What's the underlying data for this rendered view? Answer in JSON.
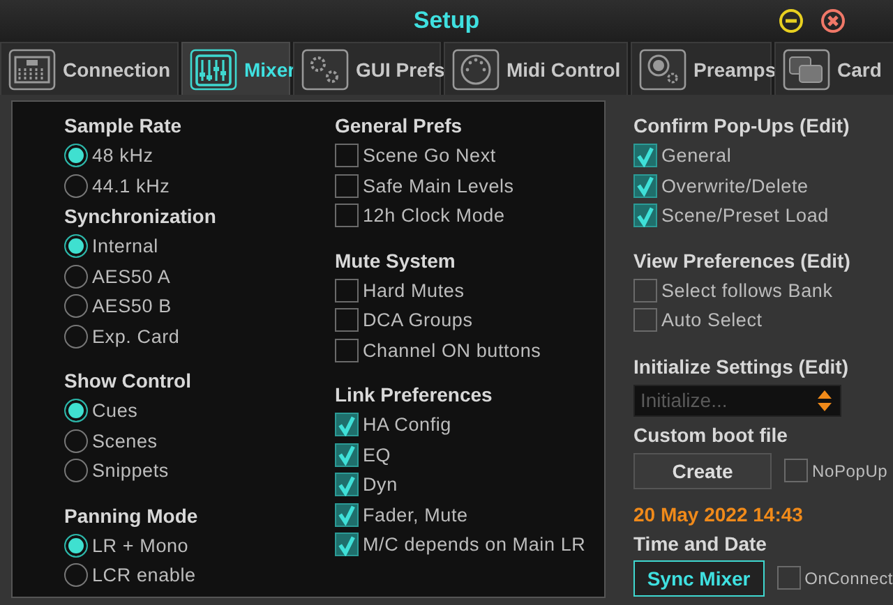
{
  "window": {
    "title": "Setup"
  },
  "tabs": [
    {
      "label": "Connection",
      "selected": false
    },
    {
      "label": "Mixer",
      "selected": true
    },
    {
      "label": "GUI Prefs",
      "selected": false
    },
    {
      "label": "Midi Control",
      "selected": false
    },
    {
      "label": "Preamps",
      "selected": false
    },
    {
      "label": "Card",
      "selected": false
    }
  ],
  "columns": [
    [
      {
        "heading": "Sample Rate",
        "kind": "radio",
        "items": [
          {
            "label": "48 kHz",
            "selected": true
          },
          {
            "label": "44.1 kHz",
            "selected": false
          }
        ]
      },
      {
        "heading": "Synchronization",
        "kind": "radio",
        "items": [
          {
            "label": "Internal",
            "selected": true
          },
          {
            "label": "AES50 A",
            "selected": false
          },
          {
            "label": "AES50 B",
            "selected": false
          },
          {
            "label": "Exp. Card",
            "selected": false
          }
        ]
      },
      {
        "heading": "Show Control",
        "kind": "radio",
        "items": [
          {
            "label": "Cues",
            "selected": true
          },
          {
            "label": "Scenes",
            "selected": false
          },
          {
            "label": "Snippets",
            "selected": false
          }
        ]
      },
      {
        "heading": "Panning Mode",
        "kind": "radio",
        "items": [
          {
            "label": "LR + Mono",
            "selected": true
          },
          {
            "label": "LCR enable",
            "selected": false
          }
        ]
      }
    ],
    [
      {
        "heading": "General Prefs",
        "kind": "check",
        "items": [
          {
            "label": "Scene Go Next",
            "checked": false
          },
          {
            "label": "Safe Main Levels",
            "checked": false
          },
          {
            "label": "12h Clock Mode",
            "checked": false
          }
        ]
      },
      {
        "heading": "Mute System",
        "kind": "check",
        "items": [
          {
            "label": "Hard Mutes",
            "checked": false
          },
          {
            "label": "DCA Groups",
            "checked": false
          },
          {
            "label": "Channel ON buttons",
            "checked": false
          }
        ]
      },
      {
        "heading": "Link Preferences",
        "kind": "check",
        "items": [
          {
            "label": "HA Config",
            "checked": true
          },
          {
            "label": "EQ",
            "checked": true
          },
          {
            "label": "Dyn",
            "checked": true
          },
          {
            "label": "Fader, Mute",
            "checked": true
          },
          {
            "label": "M/C depends on Main LR",
            "checked": true
          }
        ]
      }
    ]
  ],
  "confirm_popups": {
    "heading": "Confirm Pop-Ups (Edit)",
    "kind": "check",
    "items": [
      {
        "label": "General",
        "checked": true
      },
      {
        "label": "Overwrite/Delete",
        "checked": true
      },
      {
        "label": "Scene/Preset Load",
        "checked": true
      }
    ]
  },
  "view_preferences": {
    "heading": "View Preferences (Edit)",
    "kind": "check",
    "items": [
      {
        "label": "Select follows Bank",
        "checked": false
      },
      {
        "label": "Auto Select",
        "checked": false
      }
    ]
  },
  "initialize": {
    "heading": "Initialize Settings (Edit)",
    "placeholder": "Initialize..."
  },
  "boot_file": {
    "heading": "Custom boot file",
    "button": "Create",
    "option": {
      "label": "NoPopUp",
      "checked": false
    }
  },
  "time": {
    "date": "20 May 2022 14:43",
    "heading": "Time and Date",
    "button": "Sync Mixer",
    "option": {
      "label": "OnConnect",
      "checked": false
    }
  }
}
